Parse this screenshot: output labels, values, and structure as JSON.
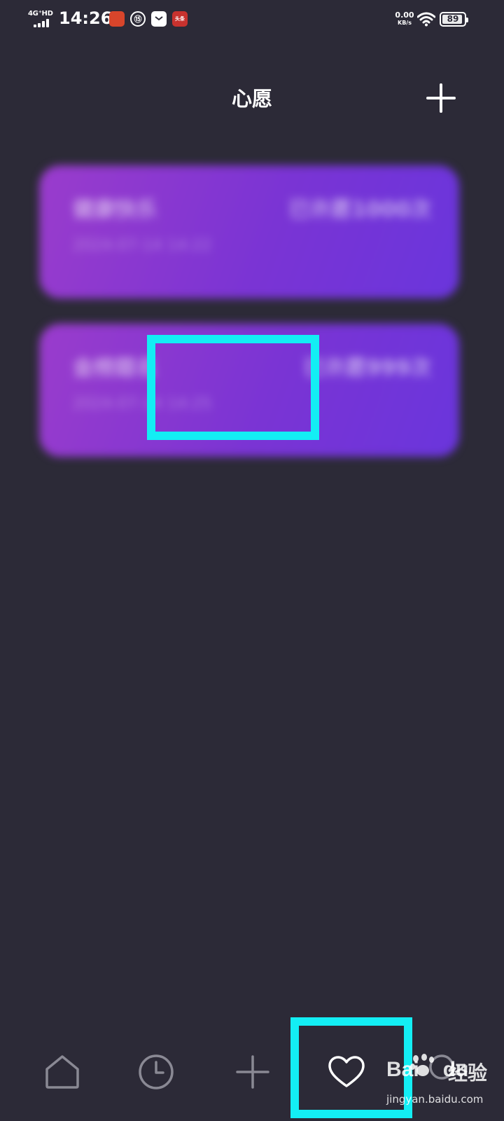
{
  "status_bar": {
    "network": "4G⁺HD",
    "time": "14:26",
    "notifications": [
      "app-icon-red",
      "app-icon-circle",
      "app-icon-bag",
      "app-icon-news"
    ],
    "notification_labels": [
      "",
      "⑮",
      "",
      "头条"
    ],
    "speed_value": "0.00",
    "speed_unit": "KB/s",
    "battery": "89"
  },
  "header": {
    "title": "心愿"
  },
  "wishes": [
    {
      "name": "健康快乐",
      "count": "已许愿1000次",
      "time": "2024-07-14 14:22"
    },
    {
      "name": "金榜题名",
      "count": "已许愿999次",
      "time": "2024-07-14 14:25"
    }
  ],
  "bottom_nav": {
    "items": [
      "home-icon",
      "clock-icon",
      "plus-icon",
      "heart-icon",
      "profile-icon"
    ],
    "active": "heart-icon"
  },
  "watermark": {
    "logo": "Bai",
    "logo_suffix": "du",
    "text": "经验",
    "url": "jingyan.baidu.com"
  },
  "colors": {
    "background": "#2c2a37",
    "card_gradient_start": "#9a3ccc",
    "card_gradient_end": "#6a35dc",
    "highlight": "#13eef4"
  }
}
